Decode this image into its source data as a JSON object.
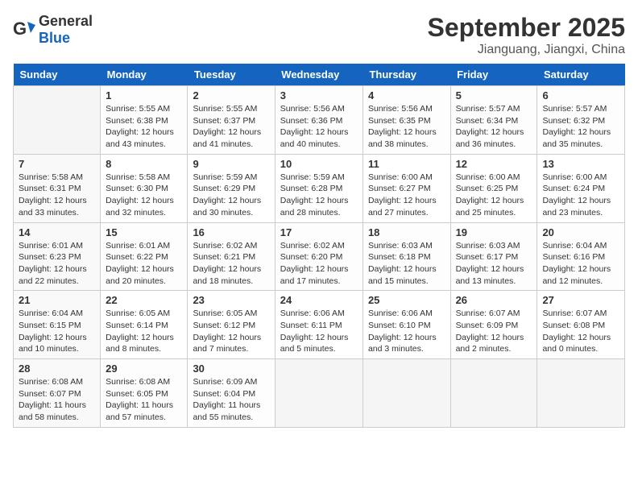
{
  "header": {
    "logo_general": "General",
    "logo_blue": "Blue",
    "month_title": "September 2025",
    "location": "Jianguang, Jiangxi, China"
  },
  "weekdays": [
    "Sunday",
    "Monday",
    "Tuesday",
    "Wednesday",
    "Thursday",
    "Friday",
    "Saturday"
  ],
  "weeks": [
    [
      {
        "day": "",
        "info": ""
      },
      {
        "day": "1",
        "info": "Sunrise: 5:55 AM\nSunset: 6:38 PM\nDaylight: 12 hours\nand 43 minutes."
      },
      {
        "day": "2",
        "info": "Sunrise: 5:55 AM\nSunset: 6:37 PM\nDaylight: 12 hours\nand 41 minutes."
      },
      {
        "day": "3",
        "info": "Sunrise: 5:56 AM\nSunset: 6:36 PM\nDaylight: 12 hours\nand 40 minutes."
      },
      {
        "day": "4",
        "info": "Sunrise: 5:56 AM\nSunset: 6:35 PM\nDaylight: 12 hours\nand 38 minutes."
      },
      {
        "day": "5",
        "info": "Sunrise: 5:57 AM\nSunset: 6:34 PM\nDaylight: 12 hours\nand 36 minutes."
      },
      {
        "day": "6",
        "info": "Sunrise: 5:57 AM\nSunset: 6:32 PM\nDaylight: 12 hours\nand 35 minutes."
      }
    ],
    [
      {
        "day": "7",
        "info": "Sunrise: 5:58 AM\nSunset: 6:31 PM\nDaylight: 12 hours\nand 33 minutes."
      },
      {
        "day": "8",
        "info": "Sunrise: 5:58 AM\nSunset: 6:30 PM\nDaylight: 12 hours\nand 32 minutes."
      },
      {
        "day": "9",
        "info": "Sunrise: 5:59 AM\nSunset: 6:29 PM\nDaylight: 12 hours\nand 30 minutes."
      },
      {
        "day": "10",
        "info": "Sunrise: 5:59 AM\nSunset: 6:28 PM\nDaylight: 12 hours\nand 28 minutes."
      },
      {
        "day": "11",
        "info": "Sunrise: 6:00 AM\nSunset: 6:27 PM\nDaylight: 12 hours\nand 27 minutes."
      },
      {
        "day": "12",
        "info": "Sunrise: 6:00 AM\nSunset: 6:25 PM\nDaylight: 12 hours\nand 25 minutes."
      },
      {
        "day": "13",
        "info": "Sunrise: 6:00 AM\nSunset: 6:24 PM\nDaylight: 12 hours\nand 23 minutes."
      }
    ],
    [
      {
        "day": "14",
        "info": "Sunrise: 6:01 AM\nSunset: 6:23 PM\nDaylight: 12 hours\nand 22 minutes."
      },
      {
        "day": "15",
        "info": "Sunrise: 6:01 AM\nSunset: 6:22 PM\nDaylight: 12 hours\nand 20 minutes."
      },
      {
        "day": "16",
        "info": "Sunrise: 6:02 AM\nSunset: 6:21 PM\nDaylight: 12 hours\nand 18 minutes."
      },
      {
        "day": "17",
        "info": "Sunrise: 6:02 AM\nSunset: 6:20 PM\nDaylight: 12 hours\nand 17 minutes."
      },
      {
        "day": "18",
        "info": "Sunrise: 6:03 AM\nSunset: 6:18 PM\nDaylight: 12 hours\nand 15 minutes."
      },
      {
        "day": "19",
        "info": "Sunrise: 6:03 AM\nSunset: 6:17 PM\nDaylight: 12 hours\nand 13 minutes."
      },
      {
        "day": "20",
        "info": "Sunrise: 6:04 AM\nSunset: 6:16 PM\nDaylight: 12 hours\nand 12 minutes."
      }
    ],
    [
      {
        "day": "21",
        "info": "Sunrise: 6:04 AM\nSunset: 6:15 PM\nDaylight: 12 hours\nand 10 minutes."
      },
      {
        "day": "22",
        "info": "Sunrise: 6:05 AM\nSunset: 6:14 PM\nDaylight: 12 hours\nand 8 minutes."
      },
      {
        "day": "23",
        "info": "Sunrise: 6:05 AM\nSunset: 6:12 PM\nDaylight: 12 hours\nand 7 minutes."
      },
      {
        "day": "24",
        "info": "Sunrise: 6:06 AM\nSunset: 6:11 PM\nDaylight: 12 hours\nand 5 minutes."
      },
      {
        "day": "25",
        "info": "Sunrise: 6:06 AM\nSunset: 6:10 PM\nDaylight: 12 hours\nand 3 minutes."
      },
      {
        "day": "26",
        "info": "Sunrise: 6:07 AM\nSunset: 6:09 PM\nDaylight: 12 hours\nand 2 minutes."
      },
      {
        "day": "27",
        "info": "Sunrise: 6:07 AM\nSunset: 6:08 PM\nDaylight: 12 hours\nand 0 minutes."
      }
    ],
    [
      {
        "day": "28",
        "info": "Sunrise: 6:08 AM\nSunset: 6:07 PM\nDaylight: 11 hours\nand 58 minutes."
      },
      {
        "day": "29",
        "info": "Sunrise: 6:08 AM\nSunset: 6:05 PM\nDaylight: 11 hours\nand 57 minutes."
      },
      {
        "day": "30",
        "info": "Sunrise: 6:09 AM\nSunset: 6:04 PM\nDaylight: 11 hours\nand 55 minutes."
      },
      {
        "day": "",
        "info": ""
      },
      {
        "day": "",
        "info": ""
      },
      {
        "day": "",
        "info": ""
      },
      {
        "day": "",
        "info": ""
      }
    ]
  ]
}
